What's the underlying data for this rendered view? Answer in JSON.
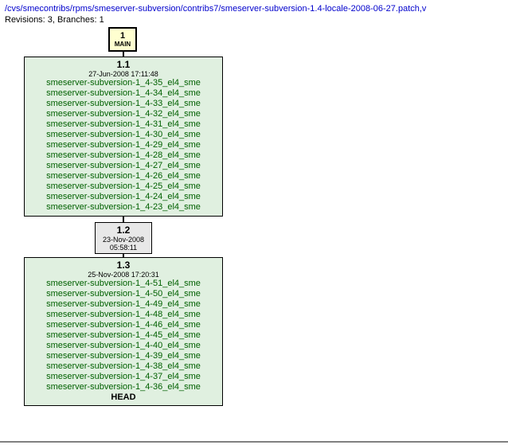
{
  "header": {
    "path": "/cvs/smecontribs/rpms/smeserver-subversion/contribs7/smeserver-subversion-1.4-locale-2008-06-27.patch,v",
    "meta": "Revisions: 3, Branches: 1"
  },
  "nodes": {
    "branch": {
      "number": "1",
      "label": "MAIN"
    },
    "r11": {
      "version": "1.1",
      "date": "27-Jun-2008 17:11:48",
      "tags": [
        "smeserver-subversion-1_4-35_el4_sme",
        "smeserver-subversion-1_4-34_el4_sme",
        "smeserver-subversion-1_4-33_el4_sme",
        "smeserver-subversion-1_4-32_el4_sme",
        "smeserver-subversion-1_4-31_el4_sme",
        "smeserver-subversion-1_4-30_el4_sme",
        "smeserver-subversion-1_4-29_el4_sme",
        "smeserver-subversion-1_4-28_el4_sme",
        "smeserver-subversion-1_4-27_el4_sme",
        "smeserver-subversion-1_4-26_el4_sme",
        "smeserver-subversion-1_4-25_el4_sme",
        "smeserver-subversion-1_4-24_el4_sme",
        "smeserver-subversion-1_4-23_el4_sme"
      ]
    },
    "r12": {
      "version": "1.2",
      "date": "23-Nov-2008 05:58:11"
    },
    "r13": {
      "version": "1.3",
      "date": "25-Nov-2008 17:20:31",
      "tags": [
        "smeserver-subversion-1_4-51_el4_sme",
        "smeserver-subversion-1_4-50_el4_sme",
        "smeserver-subversion-1_4-49_el4_sme",
        "smeserver-subversion-1_4-48_el4_sme",
        "smeserver-subversion-1_4-46_el4_sme",
        "smeserver-subversion-1_4-45_el4_sme",
        "smeserver-subversion-1_4-40_el4_sme",
        "smeserver-subversion-1_4-39_el4_sme",
        "smeserver-subversion-1_4-38_el4_sme",
        "smeserver-subversion-1_4-37_el4_sme",
        "smeserver-subversion-1_4-36_el4_sme"
      ],
      "head": "HEAD"
    }
  },
  "chart_data": {
    "type": "table",
    "title": "CVS revision graph",
    "branches": [
      "MAIN"
    ],
    "revisions": [
      {
        "rev": "1.1",
        "date": "27-Jun-2008 17:11:48",
        "tag_count": 13
      },
      {
        "rev": "1.2",
        "date": "23-Nov-2008 05:58:11",
        "tag_count": 0
      },
      {
        "rev": "1.3",
        "date": "25-Nov-2008 17:20:31",
        "tag_count": 11,
        "head": true
      }
    ]
  }
}
